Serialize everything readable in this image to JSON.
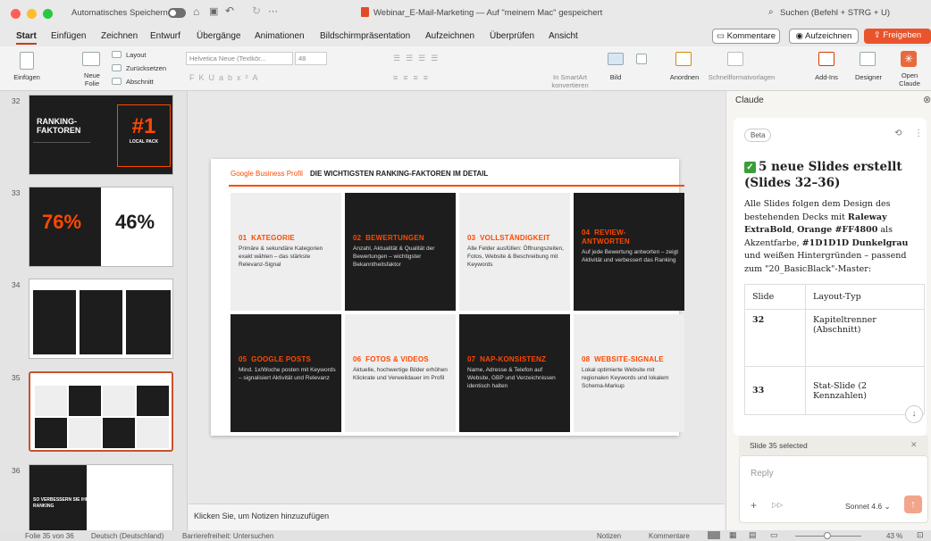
{
  "window": {
    "autosave_label": "Automatisches Speichern",
    "doc_title": "Webinar_E-Mail-Marketing — Auf \"meinem Mac\" gespeichert",
    "search_placeholder": "Suchen (Befehl + STRG + U)"
  },
  "menu": {
    "tabs": [
      "Start",
      "Einfügen",
      "Zeichnen",
      "Entwurf",
      "Übergänge",
      "Animationen",
      "Bildschirmpräsentation",
      "Aufzeichnen",
      "Überprüfen",
      "Ansicht"
    ],
    "comments": "Kommentare",
    "record": "Aufzeichnen",
    "share": "Freigeben"
  },
  "ribbon": {
    "paste": "Einfügen",
    "new_slide": "Neue\nFolie",
    "layout": "Layout",
    "reset": "Zurücksetzen",
    "section": "Abschnitt",
    "font": "Helvetica Neue (Textkör...",
    "size": "48",
    "smartart": "In SmartArt\nkonvertieren",
    "picture": "Bild",
    "arrange": "Anordnen",
    "quick_styles": "Schnellformatvorlagen",
    "addins": "Add-Ins",
    "designer": "Designer",
    "open_claude": "Open\nClaude"
  },
  "thumbs": {
    "t32": {
      "num": "32",
      "title": "RANKING-\nFAKTOREN",
      "big": "#1",
      "sub": "LOCAL PACK"
    },
    "t33": {
      "num": "33",
      "v1": "76%",
      "v2": "46%"
    },
    "t34": {
      "num": "34"
    },
    "t35": {
      "num": "35"
    },
    "t36": {
      "num": "36",
      "title": "SO VERBESSERN SIE IHR\nRANKING"
    }
  },
  "slide": {
    "kicker": "Google Business Profil",
    "heading": "DIE WICHTIGSTEN RANKING-FAKTOREN IM DETAIL",
    "cards": [
      {
        "title": "01  KATEGORIE",
        "desc": "Primäre & sekundäre Kategorien exakt wählen – das stärkste Relevanz-Signal"
      },
      {
        "title": "02  BEWERTUNGEN",
        "desc": "Anzahl, Aktualität & Qualität der Bewertungen – wichtigster Bekanntheitsfaktor"
      },
      {
        "title": "03  VOLLSTÄNDIGKEIT",
        "desc": "Alle Felder ausfüllen: Öffnungszeiten, Fotos, Website & Beschreibung mit Keywords"
      },
      {
        "title": "04  REVIEW-\nANTWORTEN",
        "desc": "Auf jede Bewertung antworten – zeigt Aktivität und verbessert das Ranking"
      },
      {
        "title": "05  GOOGLE POSTS",
        "desc": "Mind. 1x/Woche posten mit Keywords – signalisiert Aktivität und Relevanz"
      },
      {
        "title": "06  FOTOS & VIDEOS",
        "desc": "Aktuelle, hochwertige Bilder erhöhen Klickrate und Verweildauer im Profil"
      },
      {
        "title": "07  NAP-KONSISTENZ",
        "desc": "Name, Adresse & Telefon auf Website, GBP und Verzeichnissen identisch halten"
      },
      {
        "title": "08  WEBSITE-SIGNALE",
        "desc": "Lokal optimierte Website mit regionalen Keywords und lokalem Schema-Markup"
      }
    ]
  },
  "notes_placeholder": "Klicken Sie, um Notizen hinzuzufügen",
  "claude": {
    "header": "Claude",
    "badge": "Beta",
    "headline": "5 neue Slides erstellt (Slides 32–36)",
    "body_1": "Alle Slides folgen dem Design des bestehenden Decks mit ",
    "b1": "Raleway ExtraBold",
    "body_2": ", ",
    "b2": "Orange #FF4800",
    "body_3": " als Akzentfarbe, ",
    "b3": "#1D1D1D Dunkelgrau",
    "body_4": " und weißen Hintergründen – passend zum \"20_BasicBlack\"-Master:",
    "table": {
      "h1": "Slide",
      "h2": "Layout-Typ",
      "rows": [
        [
          "32",
          "Kapiteltrenner (Abschnitt)"
        ],
        [
          "33",
          "Stat-Slide (2 Kennzahlen)"
        ]
      ]
    },
    "selected": "Slide 35 selected",
    "reply_placeholder": "Reply",
    "model": "Sonnet 4.6"
  },
  "status": {
    "slide": "Folie 35 von 36",
    "lang": "Deutsch (Deutschland)",
    "access": "Barrierefreiheit: Untersuchen",
    "notes": "Notizen",
    "comments": "Kommentare",
    "zoom": "43 %"
  },
  "colors": {
    "accent": "#FF4800",
    "dark": "#1D1D1D",
    "share": "#E9542C"
  }
}
